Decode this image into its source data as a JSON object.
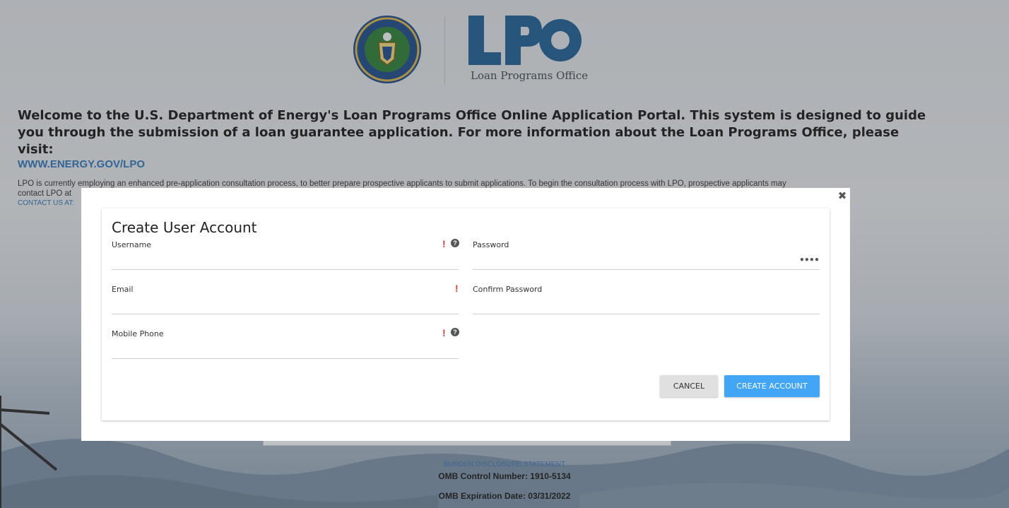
{
  "logo": {
    "seal_text": "DEPARTMENT OF ENERGY · UNITED STATES OF AMERICA",
    "lpo_letters": "LPO",
    "lpo_subtitle": "Loan Programs Office"
  },
  "welcome": {
    "text": "Welcome to the U.S. Department of Energy's Loan Programs Office Online Application Portal. This system is designed to guide you through the submission of a loan guarantee application. For more information about the Loan Programs Office, please visit:",
    "link": "WWW.ENERGY.GOV/LPO",
    "intro_line1": "LPO is currently employing an enhanced pre-application consultation process, to better prepare prospective applicants to submit applications. To begin the consultation process with LPO, prospective applicants may",
    "intro_line2": "contact LPO at",
    "contact": "CONTACT US AT:"
  },
  "modal": {
    "title": "Create User Account",
    "close_symbol": "✖",
    "fields": {
      "username": {
        "label": "Username",
        "value": "",
        "required_mark": "!",
        "help_mark": "?"
      },
      "password": {
        "label": "Password",
        "value": "",
        "dots": "●●●●"
      },
      "email": {
        "label": "Email",
        "value": "",
        "required_mark": "!"
      },
      "confirm_password": {
        "label": "Confirm Password",
        "value": ""
      },
      "mobile_phone": {
        "label": "Mobile Phone",
        "value": "",
        "required_mark": "!",
        "help_mark": "?"
      }
    },
    "buttons": {
      "cancel": "CANCEL",
      "create": "CREATE ACCOUNT"
    }
  },
  "footer": {
    "burden": "BURDEN DISCLOSURE STATEMENT",
    "omb_control": "OMB Control Number: 1910-5134",
    "omb_expiration": "OMB Expiration Date: 03/31/2022"
  },
  "colors": {
    "link_blue": "#2f73b7",
    "primary_button": "#42a5f5",
    "required_red": "#e53935",
    "lpo_blue": "#1f5f94"
  }
}
